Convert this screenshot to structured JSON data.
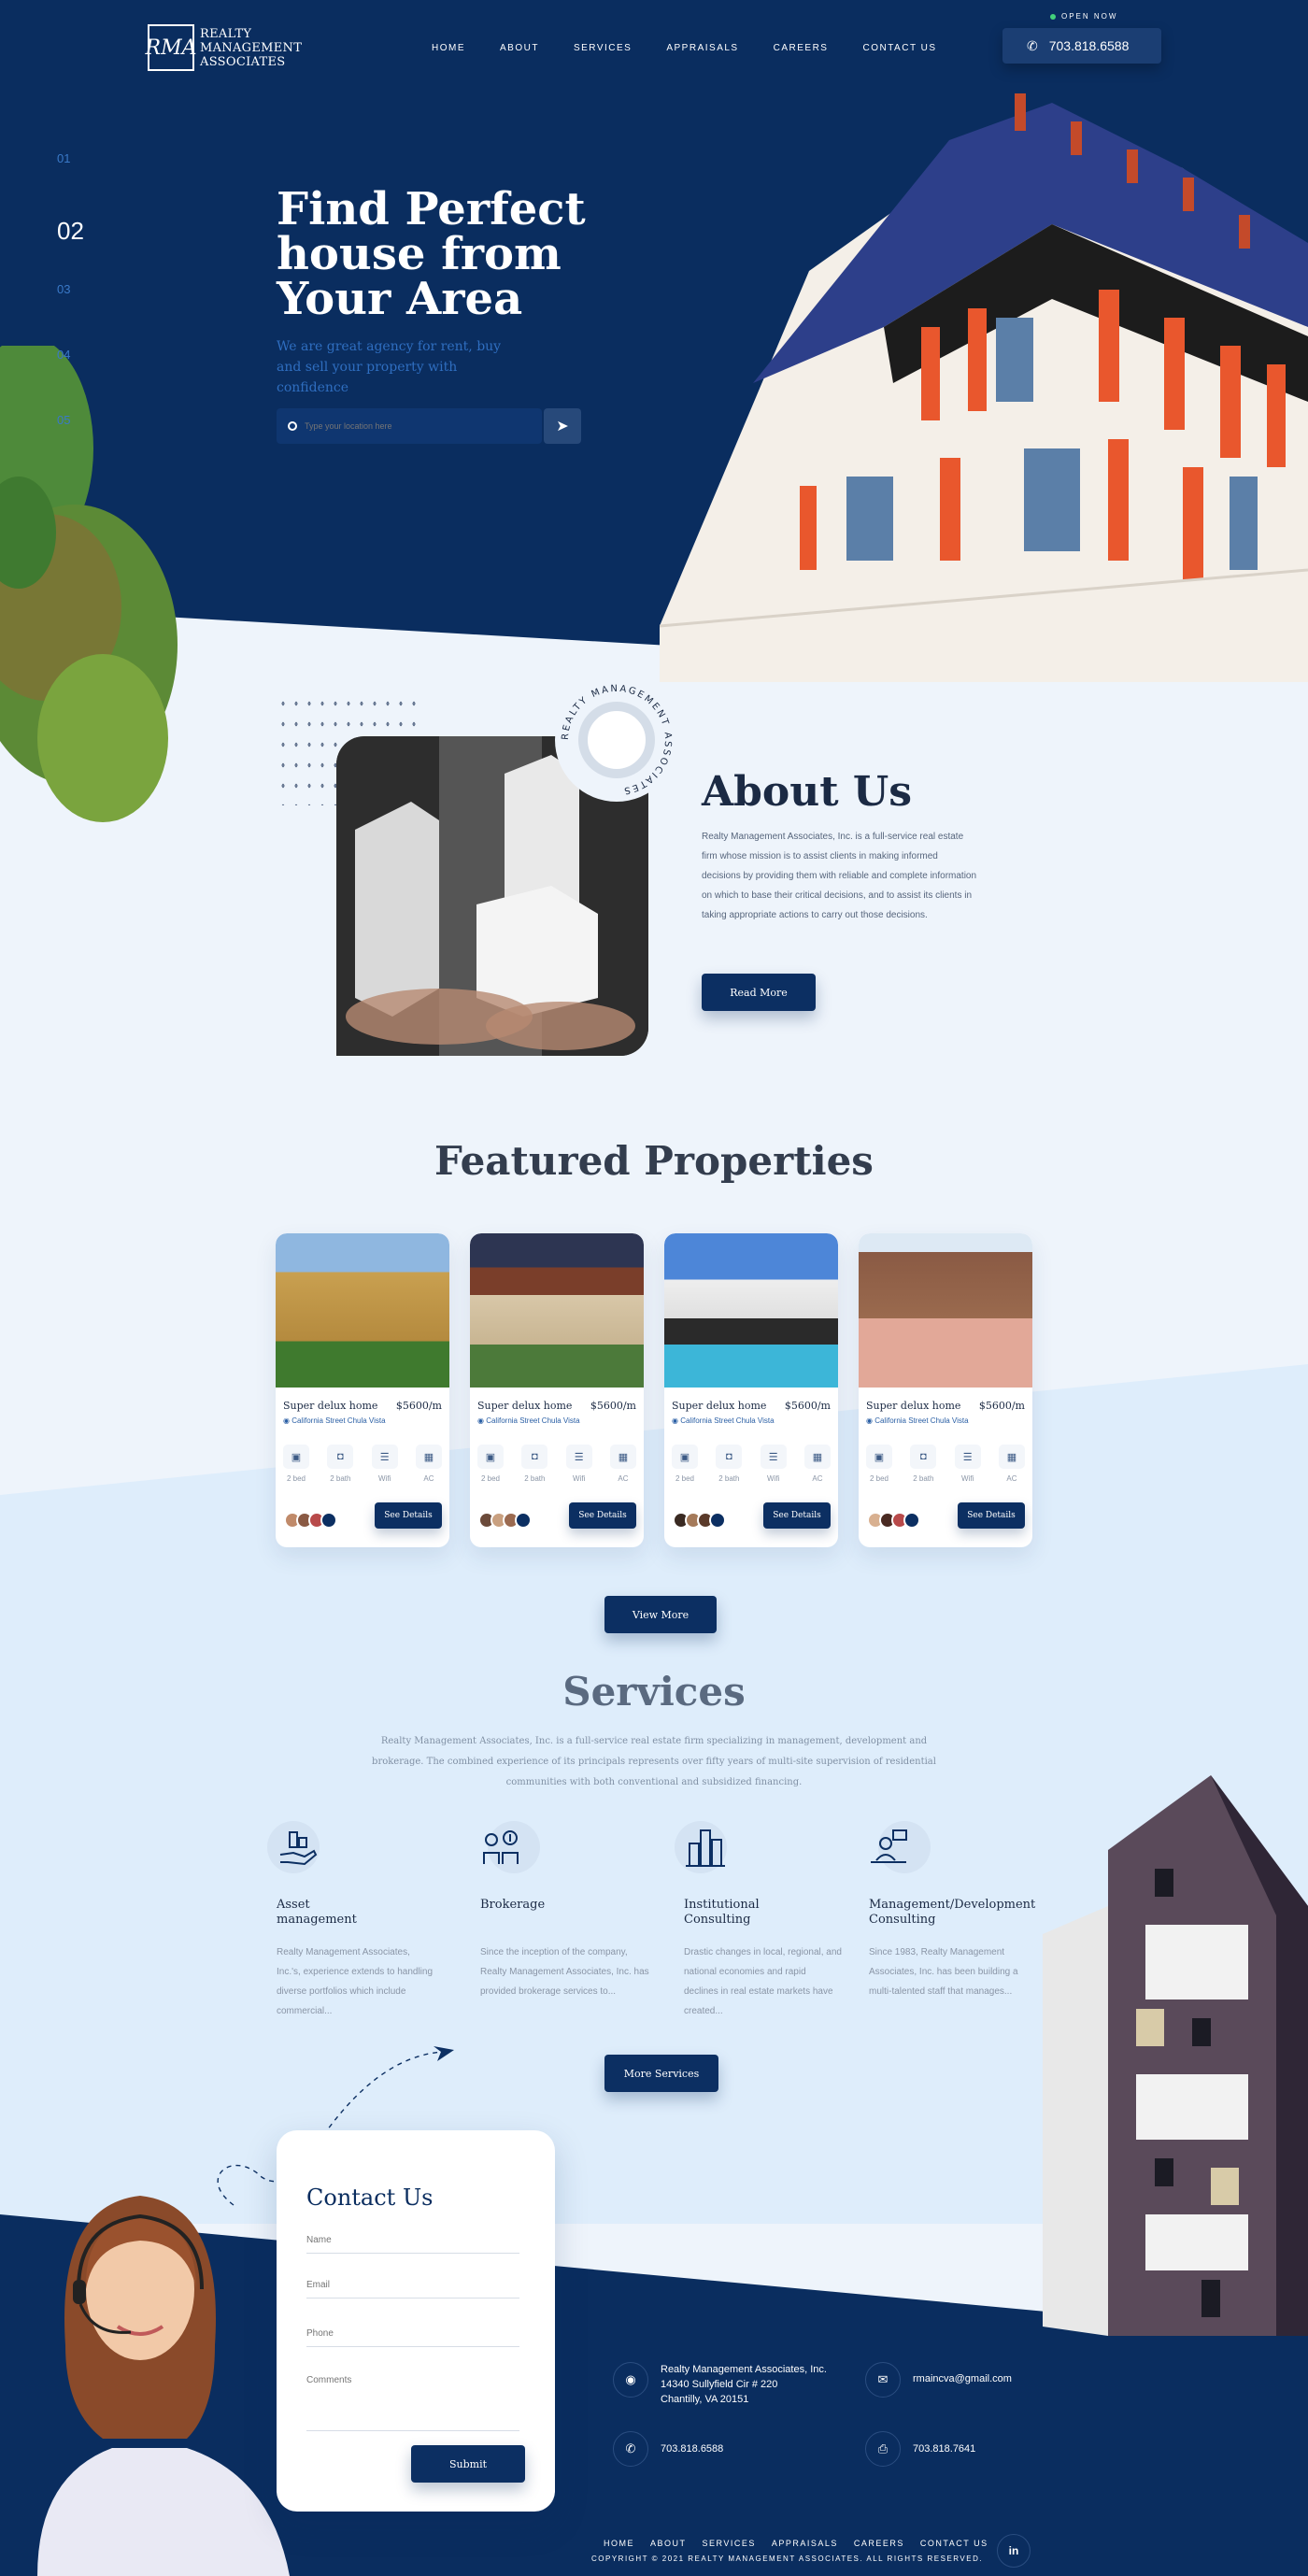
{
  "brand": {
    "logo_mark": "RMA",
    "name_line1": "REALTY",
    "name_line2": "MANAGEMENT",
    "name_line3": "ASSOCIATES"
  },
  "nav": [
    "HOME",
    "ABOUT",
    "SERVICES",
    "APPRAISALS",
    "CAREERS",
    "CONTACT US"
  ],
  "header": {
    "open_now": "OPEN NOW",
    "phone": "703.818.6588"
  },
  "hero": {
    "slides": [
      "01",
      "02",
      "03",
      "04",
      "05"
    ],
    "title_line1": "Find Perfect",
    "title_line2": "house from",
    "title_line3": "Your Area",
    "subtitle": "We are great agency for rent, buy and sell your property with confidence",
    "search_placeholder": "Type your location here"
  },
  "about": {
    "ring_text": "REALTY MANAGEMENT ASSOCIATES",
    "title": "About Us",
    "text": "Realty Management Associates, Inc. is a full-service real estate firm whose mission is to assist clients in making informed decisions by providing them with reliable and complete information on which to base their critical decisions, and to assist its clients in taking appropriate actions to carry out those decisions.",
    "button": "Read More"
  },
  "featured": {
    "title": "Featured Properties",
    "cards": [
      {
        "name": "Super delux home",
        "price": "$5600/m",
        "location": "California Street Chula Vista"
      },
      {
        "name": "Super delux home",
        "price": "$5600/m",
        "location": "California Street Chula Vista"
      },
      {
        "name": "Super delux home",
        "price": "$5600/m",
        "location": "California Street Chula Vista"
      },
      {
        "name": "Super delux home",
        "price": "$5600/m",
        "location": "California Street Chula Vista"
      }
    ],
    "amenities": [
      "2 bed",
      "2 bath",
      "Wifi",
      "AC"
    ],
    "see_details": "See Details",
    "view_more": "View More"
  },
  "services": {
    "title": "Services",
    "intro": "Realty Management Associates, Inc. is a full-service real estate firm specializing in management, development and brokerage. The combined experience of its principals represents over fifty years of multi-site supervision of residential communities with both conventional and subsidized financing.",
    "items": [
      {
        "title_line1": "Asset",
        "title_line2": "management",
        "text": "Realty Management Associates, Inc.'s, experience extends to handling diverse portfolios which include commercial...",
        "icon": "hand-buildings-icon"
      },
      {
        "title_line1": "Brokerage",
        "title_line2": "",
        "text": "Since the inception of the company, Realty Management Associates, Inc. has provided brokerage services to...",
        "icon": "broker-dollar-icon"
      },
      {
        "title_line1": "Institutional",
        "title_line2": "Consulting",
        "text": "Drastic changes in local, regional, and national economies and rapid declines in real estate markets have created...",
        "icon": "skyscraper-icon"
      },
      {
        "title_line1": "Management/Development",
        "title_line2": "Consulting",
        "text": "Since 1983, Realty Management Associates, Inc. has been building a multi-talented staff that manages...",
        "icon": "consultant-desk-icon"
      }
    ],
    "button": "More Services"
  },
  "contact": {
    "title": "Contact Us",
    "name_placeholder": "Name",
    "email_placeholder": "Email",
    "phone_placeholder": "Phone",
    "comments_placeholder": "Comments",
    "submit": "Submit"
  },
  "footer": {
    "company": "Realty Management Associates, Inc.",
    "street": "14340 Sullyfield Cir # 220",
    "city": "Chantilly, VA 20151",
    "email": "rmaincva@gmail.com",
    "phone": "703.818.6588",
    "fax": "703.818.7641",
    "nav": [
      "HOME",
      "ABOUT",
      "SERVICES",
      "APPRAISALS",
      "CAREERS",
      "CONTACT US"
    ],
    "copyright": "COPYRIGHT © 2021 REALTY MANAGEMENT ASSOCIATES. ALL RIGHTS RESERVED.",
    "social": "in"
  },
  "colors": {
    "navy": "#0a2d5f",
    "button": "#0c2f62",
    "accent_blue": "#2f6ec0",
    "light_bg": "#eef4fb",
    "online_dot": "#43d17b"
  }
}
